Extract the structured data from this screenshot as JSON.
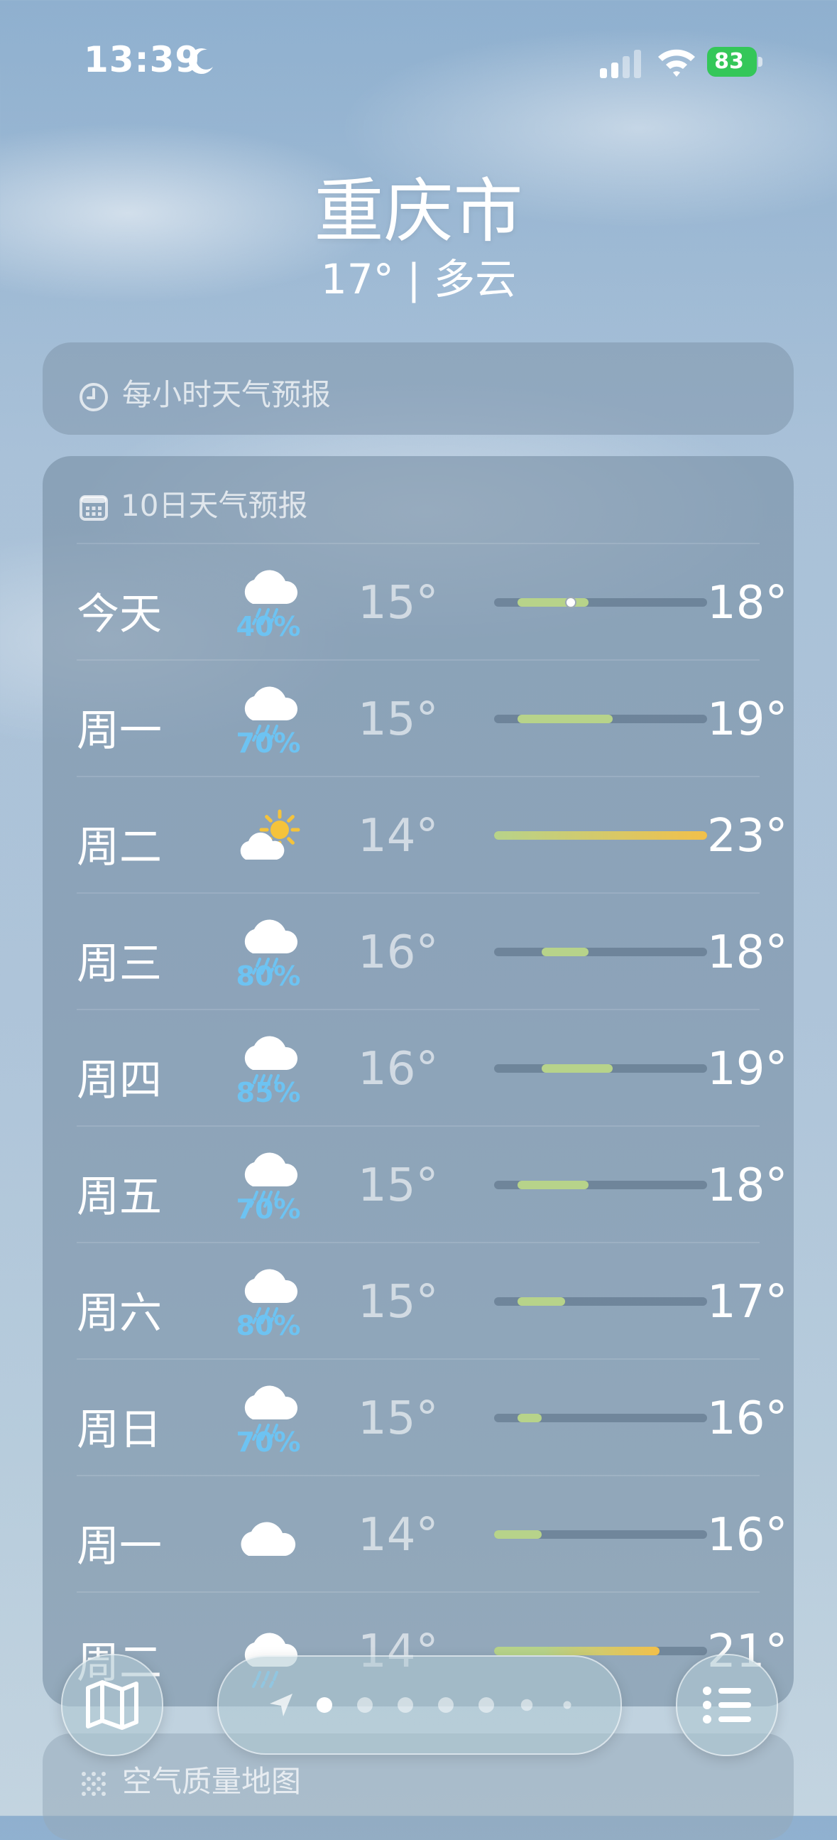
{
  "status_bar": {
    "time": "13:39",
    "battery": "83"
  },
  "location": {
    "city": "重庆市",
    "current": "17° | 多云"
  },
  "hourly": {
    "title": "每小时天气预报"
  },
  "forecast": {
    "title": "10日天气预报",
    "days": [
      {
        "day": "今天",
        "icon": "cloud-rain-icon",
        "pop": "40%",
        "low": "15°",
        "high": "18°",
        "now": true
      },
      {
        "day": "周一",
        "icon": "cloud-rain-icon",
        "pop": "70%",
        "low": "15°",
        "high": "19°"
      },
      {
        "day": "周二",
        "icon": "partly-sunny-icon",
        "pop": "",
        "low": "14°",
        "high": "23°"
      },
      {
        "day": "周三",
        "icon": "cloud-rain-icon",
        "pop": "80%",
        "low": "16°",
        "high": "18°"
      },
      {
        "day": "周四",
        "icon": "cloud-heavy-rain-icon",
        "pop": "85%",
        "low": "16°",
        "high": "19°"
      },
      {
        "day": "周五",
        "icon": "cloud-heavy-rain-icon",
        "pop": "70%",
        "low": "15°",
        "high": "18°"
      },
      {
        "day": "周六",
        "icon": "cloud-rain-icon",
        "pop": "80%",
        "low": "15°",
        "high": "17°"
      },
      {
        "day": "周日",
        "icon": "cloud-rain-icon",
        "pop": "70%",
        "low": "15°",
        "high": "16°"
      },
      {
        "day": "周一",
        "icon": "cloud-icon",
        "pop": "",
        "low": "14°",
        "high": "16°"
      },
      {
        "day": "周二",
        "icon": "cloud-rain-icon",
        "pop": "",
        "low": "14°",
        "high": "21°"
      }
    ]
  },
  "air_quality": {
    "title": "空气质量地图"
  },
  "toolbar": {
    "page_count": 7,
    "active_page": 1
  },
  "colors": {
    "rain": "#6dc3f2",
    "cool": "#b7d38a",
    "warm": "#f2c04a"
  }
}
